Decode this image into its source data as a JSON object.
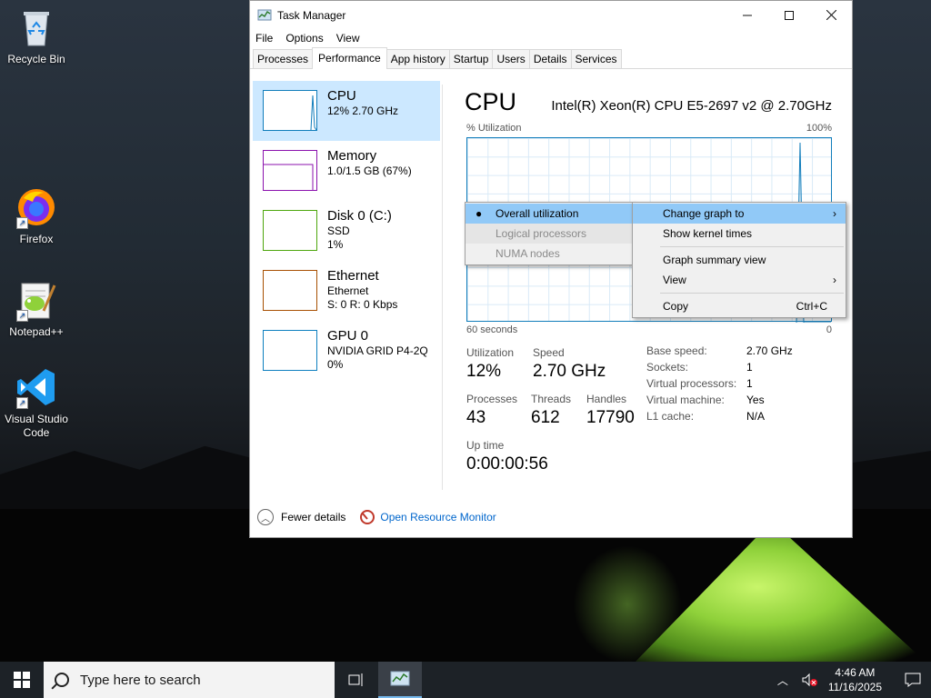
{
  "desktop": {
    "icons": [
      {
        "label": "Recycle Bin",
        "icon": "recycle-bin-icon"
      },
      {
        "label": "Firefox",
        "icon": "firefox-icon"
      },
      {
        "label": "Notepad++",
        "icon": "notepadpp-icon"
      },
      {
        "label": "Visual Studio Code",
        "icon": "vscode-icon"
      }
    ]
  },
  "window": {
    "title": "Task Manager",
    "menu": [
      "File",
      "Options",
      "View"
    ],
    "tabs": [
      "Processes",
      "Performance",
      "App history",
      "Startup",
      "Users",
      "Details",
      "Services"
    ],
    "active_tab": "Performance",
    "resources": [
      {
        "name": "CPU",
        "sub1": "12%  2.70 GHz",
        "sub2": "",
        "color": "#117dbb"
      },
      {
        "name": "Memory",
        "sub1": "1.0/1.5 GB (67%)",
        "sub2": "",
        "color": "#8b12ae"
      },
      {
        "name": "Disk 0 (C:)",
        "sub1": "SSD",
        "sub2": "1%",
        "color": "#4da60c"
      },
      {
        "name": "Ethernet",
        "sub1": "Ethernet",
        "sub2": "S: 0  R: 0 Kbps",
        "color": "#a74f01"
      },
      {
        "name": "GPU 0",
        "sub1": "NVIDIA GRID P4-2Q",
        "sub2": "0%",
        "color": "#0d7fbf"
      }
    ],
    "cpu": {
      "title": "CPU",
      "model": "Intel(R) Xeon(R) CPU E5-2697 v2 @ 2.70GHz",
      "util_label": "% Utilization",
      "max_label": "100%",
      "axis_left": "60 seconds",
      "axis_right": "0",
      "utilization_label": "Utilization",
      "utilization_value": "12%",
      "speed_label": "Speed",
      "speed_value": "2.70 GHz",
      "processes_label": "Processes",
      "processes_value": "43",
      "threads_label": "Threads",
      "threads_value": "612",
      "handles_label": "Handles",
      "handles_value": "17790",
      "uptime_label": "Up time",
      "uptime_value": "0:00:00:56",
      "specs": [
        {
          "k": "Base speed:",
          "v": "2.70 GHz"
        },
        {
          "k": "Sockets:",
          "v": "1"
        },
        {
          "k": "Virtual processors:",
          "v": "1"
        },
        {
          "k": "Virtual machine:",
          "v": "Yes"
        },
        {
          "k": "L1 cache:",
          "v": "N/A"
        }
      ]
    },
    "footer": {
      "fewer_details": "Fewer details",
      "open_monitor": "Open Resource Monitor"
    }
  },
  "context_menu": {
    "items": [
      {
        "label": "Change graph to",
        "arrow": "›",
        "highlighted": true
      },
      {
        "label": "Show kernel times"
      },
      {
        "label": "Graph summary view"
      },
      {
        "label": "View",
        "arrow": "›"
      },
      {
        "label": "Copy",
        "shortcut": "Ctrl+C"
      }
    ]
  },
  "submenu": {
    "items": [
      {
        "label": "Overall utilization",
        "checked": true
      },
      {
        "label": "Logical processors",
        "disabled": true
      },
      {
        "label": "NUMA nodes",
        "disabled": true
      }
    ]
  },
  "taskbar": {
    "search_placeholder": "Type here to search",
    "time": "4:46 AM",
    "date": "11/16/2025"
  }
}
